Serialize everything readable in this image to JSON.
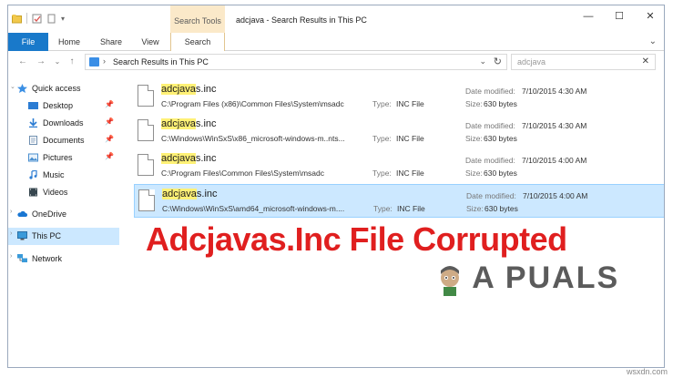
{
  "window": {
    "title": "adcjava - Search Results in This PC",
    "context_tab": "Search Tools",
    "controls": [
      "minimize",
      "maximize",
      "close"
    ]
  },
  "ribbon": {
    "tabs": [
      "File",
      "Home",
      "Share",
      "View",
      "Search"
    ],
    "active_tab": "Search",
    "file_tab_color": "#1979ca"
  },
  "address": {
    "path": "Search Results in This PC",
    "search_value": "adcjava"
  },
  "navpane": {
    "quick_access": "Quick access",
    "items": [
      {
        "label": "Desktop",
        "pinned": true
      },
      {
        "label": "Downloads",
        "pinned": true
      },
      {
        "label": "Documents",
        "pinned": true
      },
      {
        "label": "Pictures",
        "pinned": true
      },
      {
        "label": "Music",
        "pinned": false
      },
      {
        "label": "Videos",
        "pinned": false
      }
    ],
    "onedrive": "OneDrive",
    "this_pc": "This PC",
    "network": "Network"
  },
  "results": [
    {
      "name_hl": "adcjava",
      "name_rest": "s.inc",
      "path": "C:\\Program Files (x86)\\Common Files\\System\\msadc",
      "type_label": "Type:",
      "type": "INC File",
      "date_label": "Date modified:",
      "date": "7/10/2015 4:30 AM",
      "size_label": "Size:",
      "size": "630 bytes"
    },
    {
      "name_hl": "adcjava",
      "name_rest": "s.inc",
      "path": "C:\\Windows\\WinSxS\\x86_microsoft-windows-m..nts...",
      "type_label": "Type:",
      "type": "INC File",
      "date_label": "Date modified:",
      "date": "7/10/2015 4:30 AM",
      "size_label": "Size:",
      "size": "630 bytes"
    },
    {
      "name_hl": "adcjava",
      "name_rest": "s.inc",
      "path": "C:\\Program Files\\Common Files\\System\\msadc",
      "type_label": "Type:",
      "type": "INC File",
      "date_label": "Date modified:",
      "date": "7/10/2015 4:00 AM",
      "size_label": "Size:",
      "size": "630 bytes"
    },
    {
      "name_hl": "adcjava",
      "name_rest": "s.inc",
      "path": "C:\\Windows\\WinSxS\\amd64_microsoft-windows-m....",
      "type_label": "Type:",
      "type": "INC File",
      "date_label": "Date modified:",
      "date": "7/10/2015 4:00 AM",
      "size_label": "Size:",
      "size": "630 bytes",
      "selected": true
    }
  ],
  "overlay": {
    "caption": "Adcjavas.Inc File Corrupted",
    "caption_color": "#e01f1f",
    "watermark": "A PUALS",
    "site": "wsxdn.com"
  }
}
